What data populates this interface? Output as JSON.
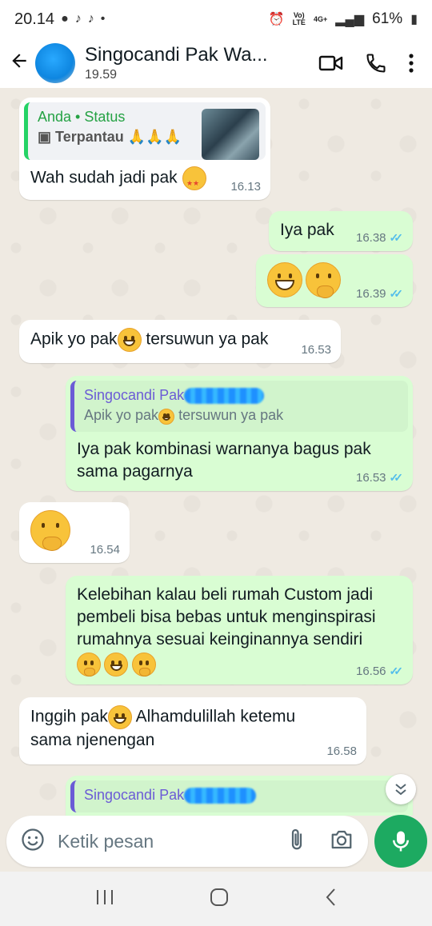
{
  "status_bar": {
    "time": "20.14",
    "battery": "61%",
    "network_label": "4G+"
  },
  "header": {
    "contact_name": "Singocandi Pak Wa...",
    "last_seen": "19.59"
  },
  "messages": [
    {
      "id": "m1",
      "quote_name": "Anda • Status",
      "quote_text": "Terpantau",
      "text": "Wah sudah jadi pak",
      "time": "16.13"
    },
    {
      "id": "m2",
      "text": "Iya pak",
      "time": "16.38"
    },
    {
      "id": "m3",
      "text": "",
      "time": "16.39"
    },
    {
      "id": "m4",
      "text_a": "Apik yo pak",
      "text_b": " tersuwun ya pak",
      "time": "16.53"
    },
    {
      "id": "m5",
      "quote_name": "Singocandi Pak",
      "quote_text_a": "Apik yo pak",
      "quote_text_b": " tersuwun ya pak",
      "text": "Iya pak kombinasi warnanya bagus pak sama pagarnya",
      "time": "16.53"
    },
    {
      "id": "m6",
      "text": "",
      "time": "16.54"
    },
    {
      "id": "m7",
      "text": "Kelebihan kalau beli rumah Custom jadi pembeli bisa bebas untuk menginspirasi rumahnya sesuai keinginannya sendiri",
      "time": "16.56"
    },
    {
      "id": "m8",
      "text_a": "Inggih pak",
      "text_b": " Alhamdulillah ketemu sama njenengan",
      "time": "16.58"
    },
    {
      "id": "m9",
      "quote_name": "Singocandi Pak"
    }
  ],
  "composer": {
    "placeholder": "Ketik pesan"
  },
  "colors": {
    "accent": "#1daa61",
    "outgoing_bubble": "#d9fdd3",
    "incoming_bubble": "#ffffff",
    "chat_bg": "#efeae2",
    "read_ticks": "#53bdeb"
  },
  "icons": [
    "back-arrow-icon",
    "video-call-icon",
    "phone-call-icon",
    "more-options-icon",
    "emoji-icon",
    "attach-icon",
    "camera-icon",
    "mic-icon",
    "scroll-down-icon",
    "recent-apps-icon",
    "home-icon",
    "back-nav-icon"
  ]
}
